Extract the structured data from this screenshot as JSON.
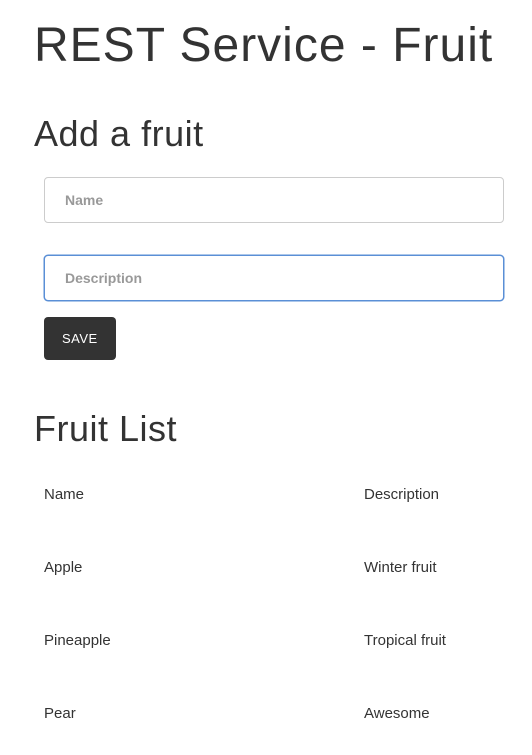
{
  "page": {
    "title": "REST Service - Fruit"
  },
  "form": {
    "section_title": "Add a fruit",
    "name_placeholder": "Name",
    "description_placeholder": "Description",
    "save_label": "SAVE"
  },
  "list": {
    "section_title": "Fruit List",
    "headers": {
      "name": "Name",
      "description": "Description"
    },
    "rows": [
      {
        "name": "Apple",
        "description": "Winter fruit"
      },
      {
        "name": "Pineapple",
        "description": "Tropical fruit"
      },
      {
        "name": "Pear",
        "description": "Awesome"
      }
    ]
  }
}
